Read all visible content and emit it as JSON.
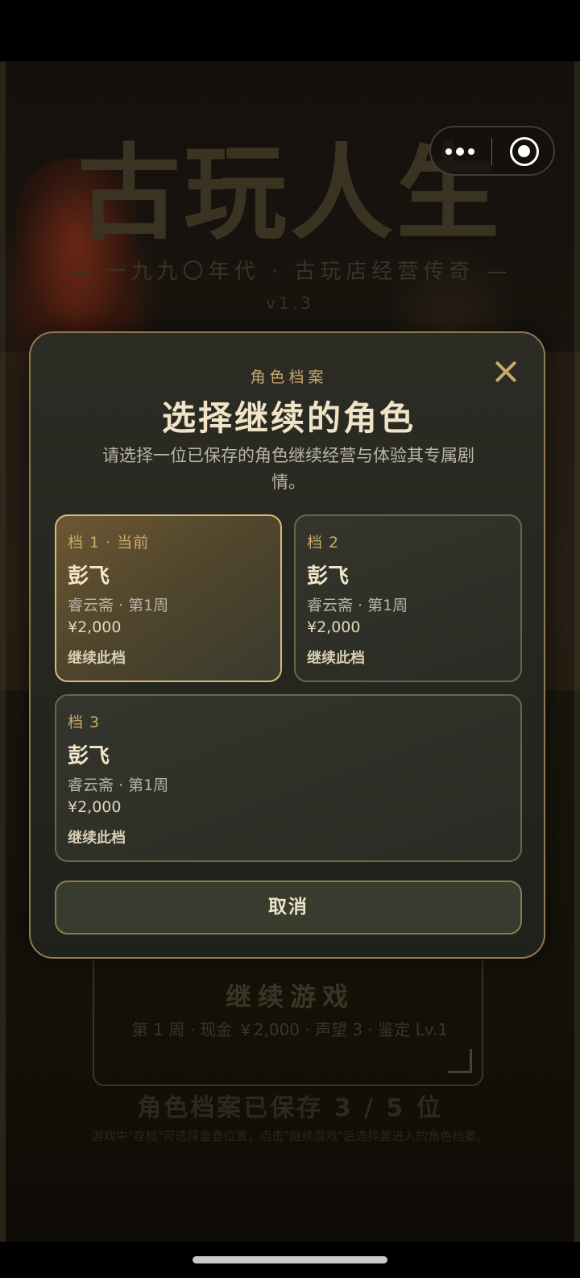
{
  "game": {
    "title": "古玩人生",
    "subtitle": "— 一九九〇年代 · 古玩店经营传奇 —",
    "version": "v1.3",
    "continue_title": "继续游戏",
    "continue_info": "第 1 周 · 现金 ￥2,000 · 声望 3 · 鉴定 Lv.1",
    "save_count": "角色档案已保存 3 / 5 位",
    "save_hint": "游戏中\"存档\"可选择重叠位置，点击\"继续游戏\"后选择要进入的角色档案。"
  },
  "capsule": {
    "more_icon": "more-dots-icon",
    "close_icon": "target-close-icon"
  },
  "modal": {
    "eyebrow": "角色档案",
    "title": "选择继续的角色",
    "description": "请选择一位已保存的角色继续经营与体验其专属剧情。",
    "close_icon": "close-x-icon",
    "slots": [
      {
        "tag": "档 1 · 当前",
        "name": "彭飞",
        "shop": "睿云斋 · 第1周",
        "money": "¥2,000",
        "action": "继续此档",
        "active": true
      },
      {
        "tag": "档 2",
        "name": "彭飞",
        "shop": "睿云斋 · 第1周",
        "money": "¥2,000",
        "action": "继续此档",
        "active": false
      },
      {
        "tag": "档 3",
        "name": "彭飞",
        "shop": "睿云斋 · 第1周",
        "money": "¥2,000",
        "action": "继续此档",
        "active": false
      }
    ],
    "cancel_label": "取消"
  },
  "colors": {
    "accent_gold": "#c8a96a",
    "modal_border": "#8d7a4f",
    "active_slot_border": "#d6bb7a",
    "title_text": "#f0e3c6"
  }
}
